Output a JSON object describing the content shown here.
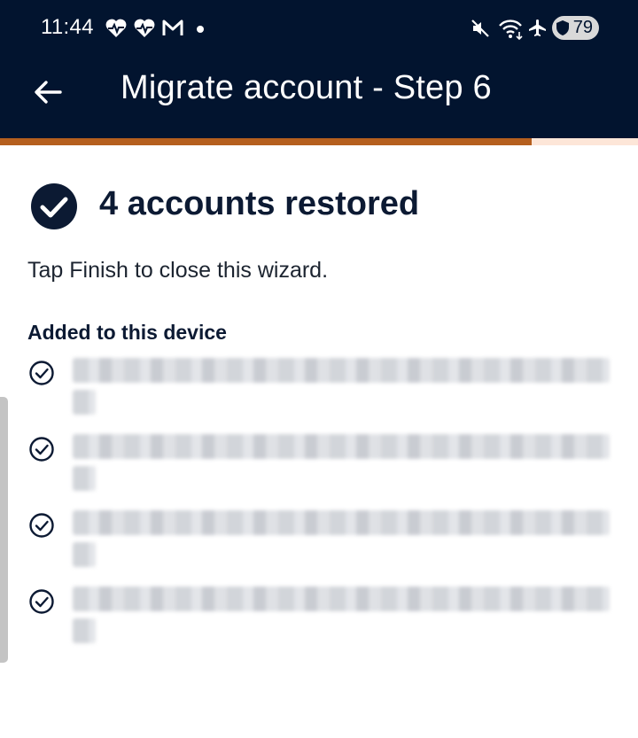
{
  "status_bar": {
    "time": "11:44",
    "battery_level": "79",
    "notification_icons": [
      "heart-pulse-icon",
      "heart-pulse-icon",
      "gmail-icon"
    ],
    "system_icons": [
      "mute-icon",
      "wifi-icon",
      "airplane-icon"
    ]
  },
  "app_bar": {
    "title": "Migrate account - Step 6",
    "back_icon": "arrow-left-icon",
    "background_color": "#02142f"
  },
  "progress": {
    "fraction": 0.833,
    "fill_color": "#b55f1e",
    "track_color": "#fde6d8"
  },
  "main": {
    "heading": "4 accounts restored",
    "subtitle": "Tap Finish to close this wizard.",
    "section_label": "Added to this device",
    "accounts": [
      {
        "icon": "check-circle-icon"
      },
      {
        "icon": "check-circle-icon"
      },
      {
        "icon": "check-circle-icon"
      },
      {
        "icon": "check-circle-icon"
      }
    ]
  }
}
